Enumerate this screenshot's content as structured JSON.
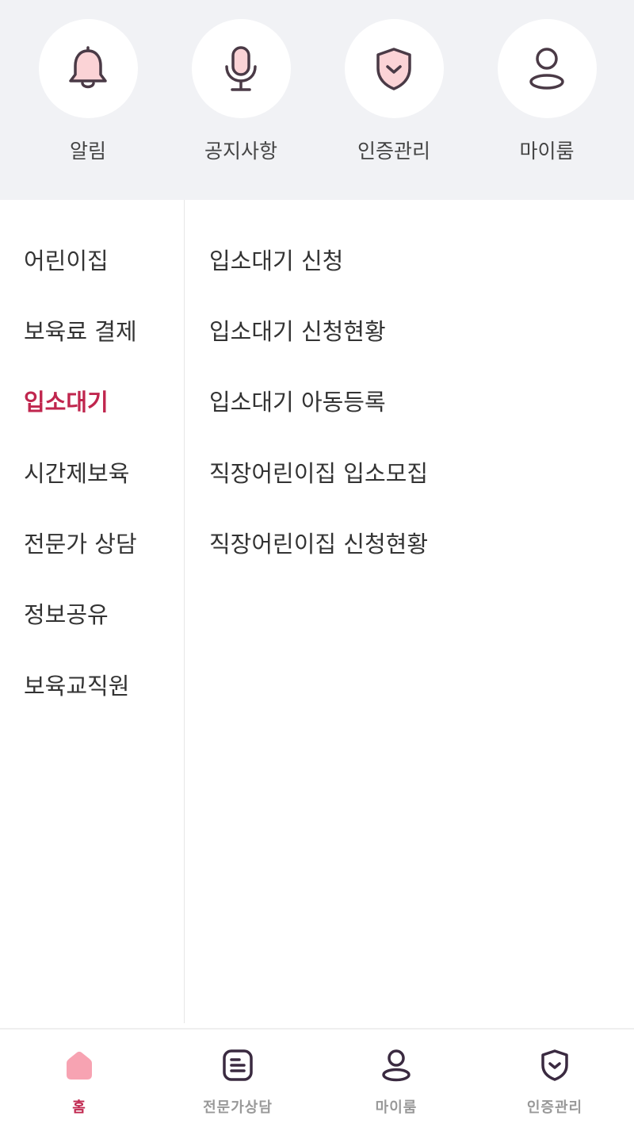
{
  "shortcuts": [
    {
      "label": "알림",
      "icon": "bell-icon"
    },
    {
      "label": "공지사항",
      "icon": "microphone-icon"
    },
    {
      "label": "인증관리",
      "icon": "shield-icon"
    },
    {
      "label": "마이룸",
      "icon": "user-icon"
    }
  ],
  "left_menu": {
    "items": [
      {
        "label": "어린이집"
      },
      {
        "label": "보육료 결제"
      },
      {
        "label": "입소대기",
        "active": true
      },
      {
        "label": "시간제보육"
      },
      {
        "label": "전문가 상담"
      },
      {
        "label": "정보공유"
      },
      {
        "label": "보육교직원"
      }
    ]
  },
  "sub_menu": {
    "items": [
      {
        "label": "입소대기 신청"
      },
      {
        "label": "입소대기 신청현황"
      },
      {
        "label": "입소대기 아동등록"
      },
      {
        "label": "직장어린이집 입소모집"
      },
      {
        "label": "직장어린이집 신청현황"
      }
    ]
  },
  "bottom_nav": {
    "items": [
      {
        "label": "홈",
        "icon": "home-icon",
        "active": true
      },
      {
        "label": "전문가상담",
        "icon": "document-icon"
      },
      {
        "label": "마이룸",
        "icon": "user-icon"
      },
      {
        "label": "인증관리",
        "icon": "shield-icon"
      }
    ]
  },
  "colors": {
    "accent": "#c0264e",
    "icon_fill": "#fbd3d6",
    "icon_stroke": "#4a3a46",
    "top_bg": "#f1f2f5"
  }
}
